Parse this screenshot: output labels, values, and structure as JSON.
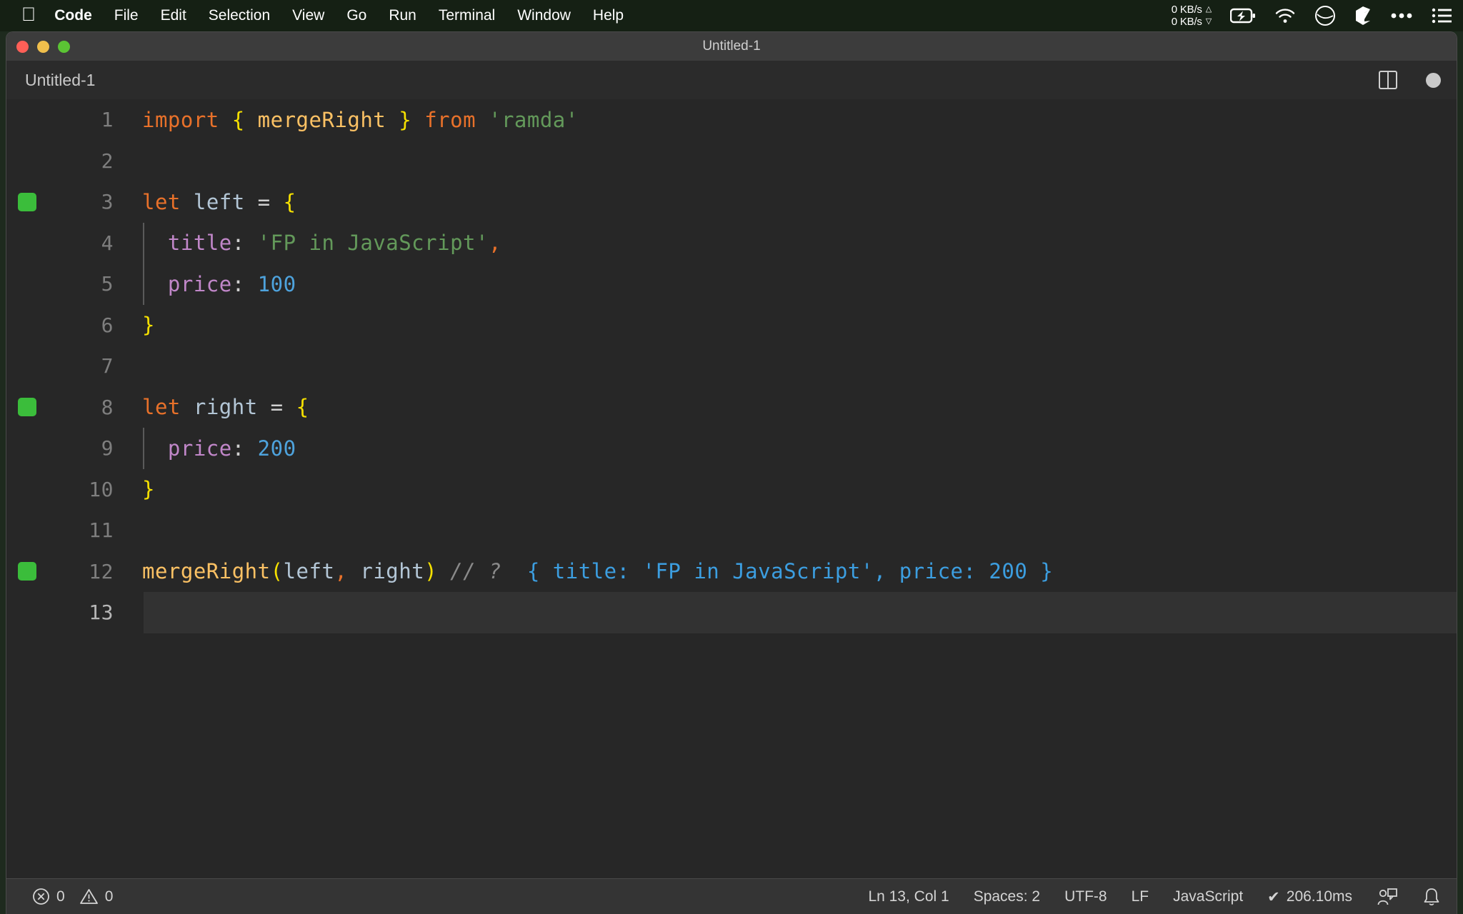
{
  "menubar": {
    "apple_icon": "apple-logo-icon",
    "items": [
      {
        "label": "Code",
        "bold": true
      },
      {
        "label": "File",
        "bold": false
      },
      {
        "label": "Edit",
        "bold": false
      },
      {
        "label": "Selection",
        "bold": false
      },
      {
        "label": "View",
        "bold": false
      },
      {
        "label": "Go",
        "bold": false
      },
      {
        "label": "Run",
        "bold": false
      },
      {
        "label": "Terminal",
        "bold": false
      },
      {
        "label": "Window",
        "bold": false
      },
      {
        "label": "Help",
        "bold": false
      }
    ],
    "status": {
      "net_up": "0 KB/s",
      "net_down": "0 KB/s",
      "icons": [
        "battery-charging-icon",
        "wifi-icon",
        "clock-icon",
        "box-icon",
        "ellipsis-icon",
        "control-center-list-icon"
      ]
    }
  },
  "window": {
    "title": "Untitled-1",
    "traffic_lights": [
      "close-button",
      "minimize-button",
      "maximize-button"
    ]
  },
  "tabbar": {
    "tab_label": "Untitled-1",
    "split_editor_label": "split-editor-right",
    "unsaved_label": "unsaved-indicator"
  },
  "editor": {
    "lines": [
      {
        "num": "1",
        "mark": false,
        "indent_guide": false,
        "active": false,
        "tokens": [
          {
            "t": "import",
            "c": "t-kw"
          },
          {
            "t": " ",
            "c": "t-op"
          },
          {
            "t": "{",
            "c": "t-brace"
          },
          {
            "t": " ",
            "c": "t-op"
          },
          {
            "t": "mergeRight",
            "c": "t-fn"
          },
          {
            "t": " ",
            "c": "t-op"
          },
          {
            "t": "}",
            "c": "t-brace"
          },
          {
            "t": " ",
            "c": "t-op"
          },
          {
            "t": "from",
            "c": "t-kw"
          },
          {
            "t": " ",
            "c": "t-op"
          },
          {
            "t": "'ramda'",
            "c": "t-str"
          }
        ]
      },
      {
        "num": "2",
        "mark": false,
        "indent_guide": false,
        "active": false,
        "tokens": []
      },
      {
        "num": "3",
        "mark": true,
        "indent_guide": false,
        "active": false,
        "tokens": [
          {
            "t": "let",
            "c": "t-kw"
          },
          {
            "t": " ",
            "c": "t-op"
          },
          {
            "t": "left",
            "c": "t-var"
          },
          {
            "t": " ",
            "c": "t-op"
          },
          {
            "t": "=",
            "c": "t-punc"
          },
          {
            "t": " ",
            "c": "t-op"
          },
          {
            "t": "{",
            "c": "t-brace"
          }
        ]
      },
      {
        "num": "4",
        "mark": false,
        "indent_guide": true,
        "active": false,
        "tokens": [
          {
            "t": "  ",
            "c": "t-op"
          },
          {
            "t": "title",
            "c": "t-prop"
          },
          {
            "t": ":",
            "c": "t-punc"
          },
          {
            "t": " ",
            "c": "t-op"
          },
          {
            "t": "'FP in JavaScript'",
            "c": "t-str"
          },
          {
            "t": ",",
            "c": "t-comma"
          }
        ]
      },
      {
        "num": "5",
        "mark": false,
        "indent_guide": true,
        "active": false,
        "tokens": [
          {
            "t": "  ",
            "c": "t-op"
          },
          {
            "t": "price",
            "c": "t-prop"
          },
          {
            "t": ":",
            "c": "t-punc"
          },
          {
            "t": " ",
            "c": "t-op"
          },
          {
            "t": "100",
            "c": "t-num"
          }
        ]
      },
      {
        "num": "6",
        "mark": false,
        "indent_guide": false,
        "active": false,
        "tokens": [
          {
            "t": "}",
            "c": "t-brace"
          }
        ]
      },
      {
        "num": "7",
        "mark": false,
        "indent_guide": false,
        "active": false,
        "tokens": []
      },
      {
        "num": "8",
        "mark": true,
        "indent_guide": false,
        "active": false,
        "tokens": [
          {
            "t": "let",
            "c": "t-kw"
          },
          {
            "t": " ",
            "c": "t-op"
          },
          {
            "t": "right",
            "c": "t-var"
          },
          {
            "t": " ",
            "c": "t-op"
          },
          {
            "t": "=",
            "c": "t-punc"
          },
          {
            "t": " ",
            "c": "t-op"
          },
          {
            "t": "{",
            "c": "t-brace"
          }
        ]
      },
      {
        "num": "9",
        "mark": false,
        "indent_guide": true,
        "active": false,
        "tokens": [
          {
            "t": "  ",
            "c": "t-op"
          },
          {
            "t": "price",
            "c": "t-prop"
          },
          {
            "t": ":",
            "c": "t-punc"
          },
          {
            "t": " ",
            "c": "t-op"
          },
          {
            "t": "200",
            "c": "t-num"
          }
        ]
      },
      {
        "num": "10",
        "mark": false,
        "indent_guide": false,
        "active": false,
        "tokens": [
          {
            "t": "}",
            "c": "t-brace"
          }
        ]
      },
      {
        "num": "11",
        "mark": false,
        "indent_guide": false,
        "active": false,
        "tokens": []
      },
      {
        "num": "12",
        "mark": true,
        "indent_guide": false,
        "active": false,
        "tokens": [
          {
            "t": "mergeRight",
            "c": "t-fn"
          },
          {
            "t": "(",
            "c": "t-brace"
          },
          {
            "t": "left",
            "c": "t-var"
          },
          {
            "t": ",",
            "c": "t-comma"
          },
          {
            "t": " ",
            "c": "t-op"
          },
          {
            "t": "right",
            "c": "t-var"
          },
          {
            "t": ")",
            "c": "t-brace"
          },
          {
            "t": " ",
            "c": "t-op"
          },
          {
            "t": "// ?",
            "c": "t-cmt"
          },
          {
            "t": "  ",
            "c": "t-op"
          },
          {
            "t": "{ title: 'FP in JavaScript', price: 200 }",
            "c": "t-result"
          }
        ]
      },
      {
        "num": "13",
        "mark": false,
        "indent_guide": false,
        "active": true,
        "bright_num": true,
        "tokens": []
      }
    ]
  },
  "statusbar": {
    "errors_icon": "error-circle-icon",
    "errors": "0",
    "warnings_icon": "warning-triangle-icon",
    "warnings": "0",
    "cursor": "Ln 13, Col 1",
    "indent": "Spaces: 2",
    "encoding": "UTF-8",
    "eol": "LF",
    "language": "JavaScript",
    "quokka_check": "✔",
    "quokka_time": "206.10ms",
    "live_share_icon": "live-share-icon",
    "bell_icon": "bell-icon"
  },
  "colors": {
    "menubar_bg": "#152014",
    "window_bg": "#272727",
    "titlebar_bg": "#3c3c3c",
    "statusbar_bg": "#343434",
    "gutter_mark": "#3bbd3b",
    "accent_result": "#3c9ee0"
  }
}
